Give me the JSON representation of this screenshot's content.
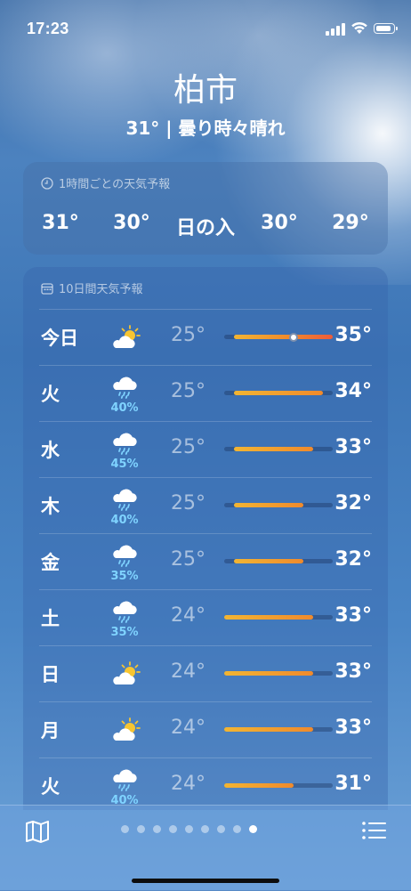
{
  "status": {
    "time": "17:23"
  },
  "location": {
    "city": "柏市",
    "summary": "31° | 曇り時々晴れ"
  },
  "hourly": {
    "title": "1時間ごとの天気予報",
    "items": [
      "31°",
      "30°",
      "日の入",
      "30°",
      "29°"
    ]
  },
  "daily": {
    "title": "10日間天気予報",
    "range": [
      24,
      35
    ],
    "days": [
      {
        "day": "今日",
        "icon": "sun-behind-cloud-icon",
        "pop": "",
        "low": "25°",
        "high": "35°",
        "lo": 25,
        "hi": 35,
        "current": 31
      },
      {
        "day": "火",
        "icon": "cloud-rain-icon",
        "pop": "40%",
        "low": "25°",
        "high": "34°",
        "lo": 25,
        "hi": 34
      },
      {
        "day": "水",
        "icon": "cloud-rain-icon",
        "pop": "45%",
        "low": "25°",
        "high": "33°",
        "lo": 25,
        "hi": 33
      },
      {
        "day": "木",
        "icon": "cloud-rain-icon",
        "pop": "40%",
        "low": "25°",
        "high": "32°",
        "lo": 25,
        "hi": 32
      },
      {
        "day": "金",
        "icon": "cloud-rain-icon",
        "pop": "35%",
        "low": "25°",
        "high": "32°",
        "lo": 25,
        "hi": 32
      },
      {
        "day": "土",
        "icon": "cloud-rain-icon",
        "pop": "35%",
        "low": "24°",
        "high": "33°",
        "lo": 24,
        "hi": 33
      },
      {
        "day": "日",
        "icon": "sun-behind-cloud-icon",
        "pop": "",
        "low": "24°",
        "high": "33°",
        "lo": 24,
        "hi": 33
      },
      {
        "day": "月",
        "icon": "sun-behind-cloud-icon",
        "pop": "",
        "low": "24°",
        "high": "33°",
        "lo": 24,
        "hi": 33
      },
      {
        "day": "火",
        "icon": "cloud-rain-icon",
        "pop": "40%",
        "low": "24°",
        "high": "31°",
        "lo": 24,
        "hi": 31
      }
    ]
  },
  "pager": {
    "count": 9,
    "active": 8
  },
  "colors": {
    "accent_precip": "#7fd3ff",
    "bar_cool": "#f2b533",
    "bar_hot": "#ee5c3a"
  }
}
